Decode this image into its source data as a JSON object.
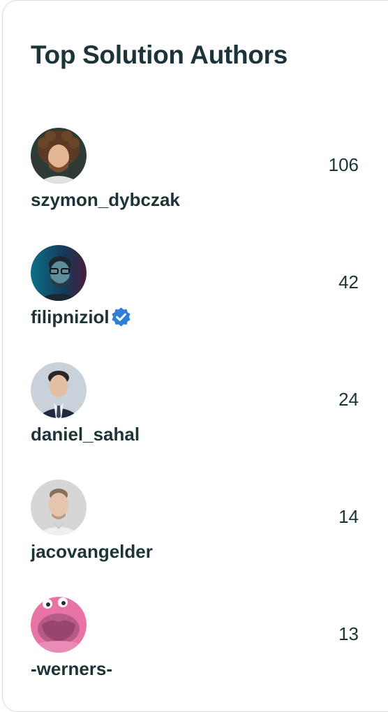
{
  "widget": {
    "title": "Top Solution Authors"
  },
  "authors": [
    {
      "username": "szymon_dybczak",
      "count": "106",
      "verified": false,
      "avatar_icon": "avatar-curly-hair-beard"
    },
    {
      "username": "filipniziol",
      "count": "42",
      "verified": true,
      "avatar_icon": "avatar-glasses-blue-light"
    },
    {
      "username": "daniel_sahal",
      "count": "24",
      "verified": false,
      "avatar_icon": "avatar-suit-tie"
    },
    {
      "username": "jacovangelder",
      "count": "14",
      "verified": false,
      "avatar_icon": "avatar-light-shirt"
    },
    {
      "username": "-werners-",
      "count": "13",
      "verified": false,
      "avatar_icon": "avatar-pink-cartoon"
    }
  ],
  "colors": {
    "text": "#1c3438",
    "border": "#d9dde0",
    "verified_badge": "#2f7fd8"
  }
}
